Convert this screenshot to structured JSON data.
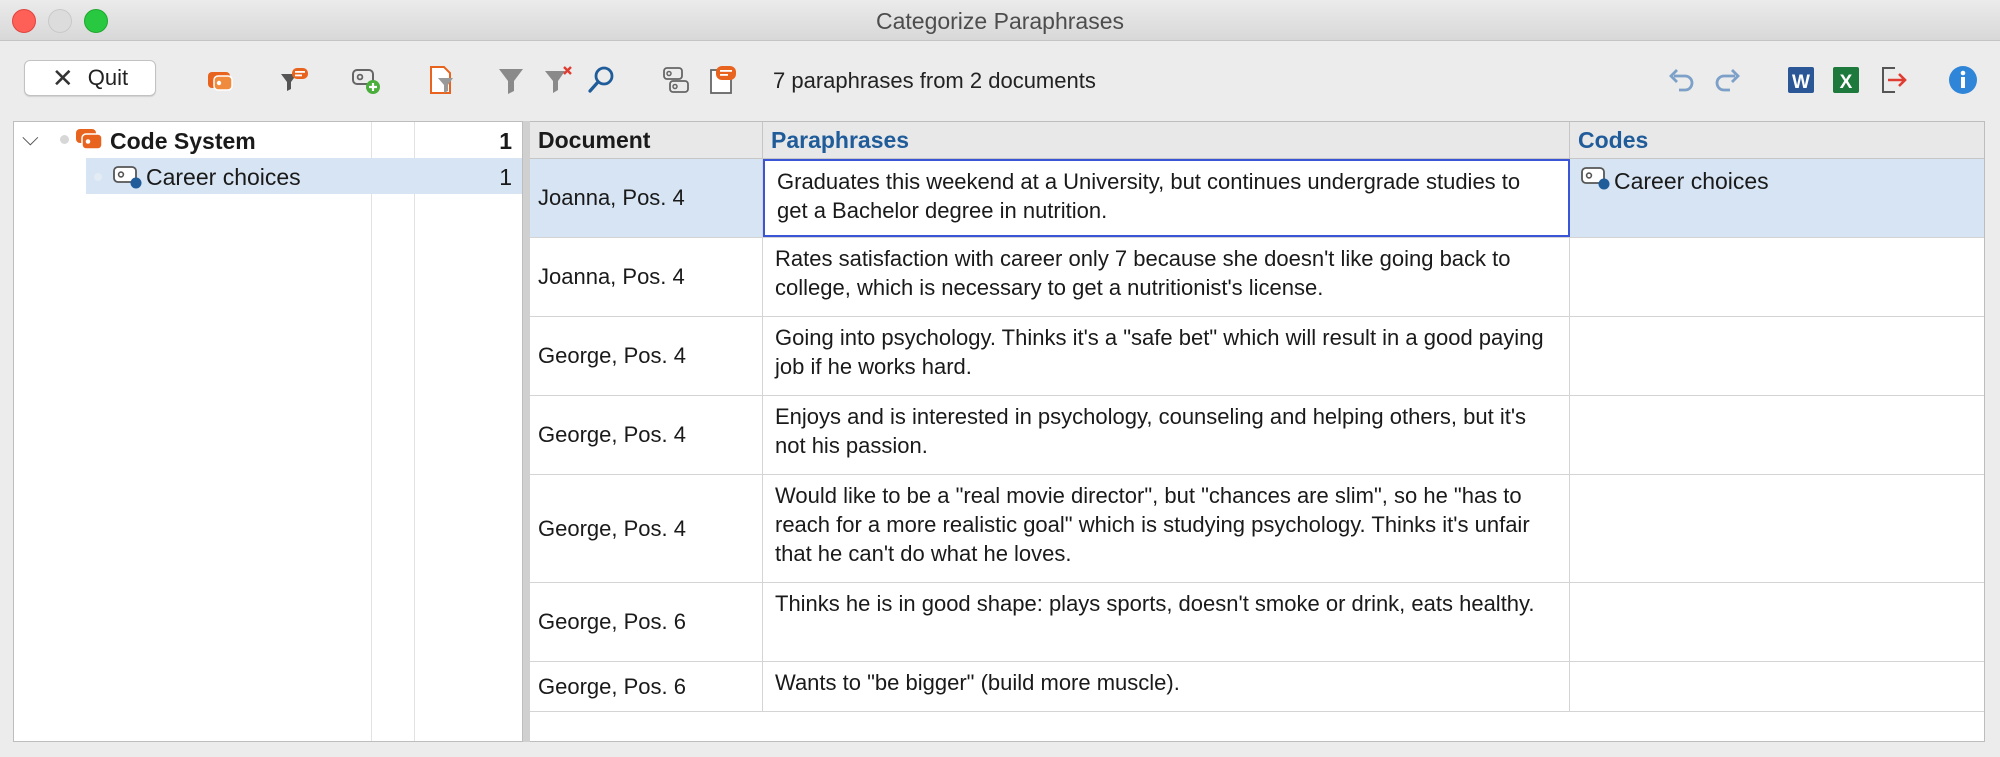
{
  "window": {
    "title": "Categorize Paraphrases"
  },
  "toolbar": {
    "quit_label": "Quit",
    "status": "7 paraphrases from 2 documents",
    "icons": [
      "code-system-icon",
      "paraphrase-filter-icon",
      "new-code-icon",
      "document-filter-icon",
      "filter-icon",
      "clear-filter-icon",
      "search-icon",
      "codes-view-icon",
      "paraphrase-memo-icon",
      "undo-icon",
      "redo-icon",
      "word-export-icon",
      "excel-export-icon",
      "export-icon",
      "info-icon"
    ],
    "colors": {
      "orange": "#e8641e",
      "blue": "#1f5c99",
      "word": "#2b5797",
      "excel": "#1e7a3c",
      "info": "#2f86d8"
    }
  },
  "code_system": {
    "root": {
      "label": "Code System",
      "count": "1"
    },
    "items": [
      {
        "label": "Career choices",
        "count": "1"
      }
    ]
  },
  "table": {
    "headers": {
      "document": "Document",
      "paraphrases": "Paraphrases",
      "codes": "Codes"
    },
    "rows": [
      {
        "document": "Joanna, Pos. 4",
        "paraphrase": "Graduates this weekend at a University, but continues undergrade studies to get a Bachelor degree in nutrition.",
        "code": "Career choices"
      },
      {
        "document": "Joanna, Pos. 4",
        "paraphrase": "Rates satisfaction with career only 7 because she doesn't like going back to college, which is necessary to get a nutritionist's license.",
        "code": ""
      },
      {
        "document": "George, Pos. 4",
        "paraphrase": "Going into psychology. Thinks it's a \"safe bet\" which will result in a good paying job if he works hard.",
        "code": ""
      },
      {
        "document": "George, Pos. 4",
        "paraphrase": "Enjoys and is interested in psychology, counseling and helping others, but it's not his passion.",
        "code": ""
      },
      {
        "document": "George, Pos. 4",
        "paraphrase": "Would like to be a \"real movie director\", but \"chances are slim\", so he \"has to reach for a more realistic goal\" which is studying psychology. Thinks it's unfair that he can't do what he loves.",
        "code": ""
      },
      {
        "document": "George, Pos. 6",
        "paraphrase": "Thinks he is in good shape: plays sports, doesn't smoke or drink, eats healthy.",
        "code": ""
      },
      {
        "document": "George, Pos. 6",
        "paraphrase": "Wants to \"be bigger\" (build more muscle).",
        "code": ""
      }
    ]
  }
}
